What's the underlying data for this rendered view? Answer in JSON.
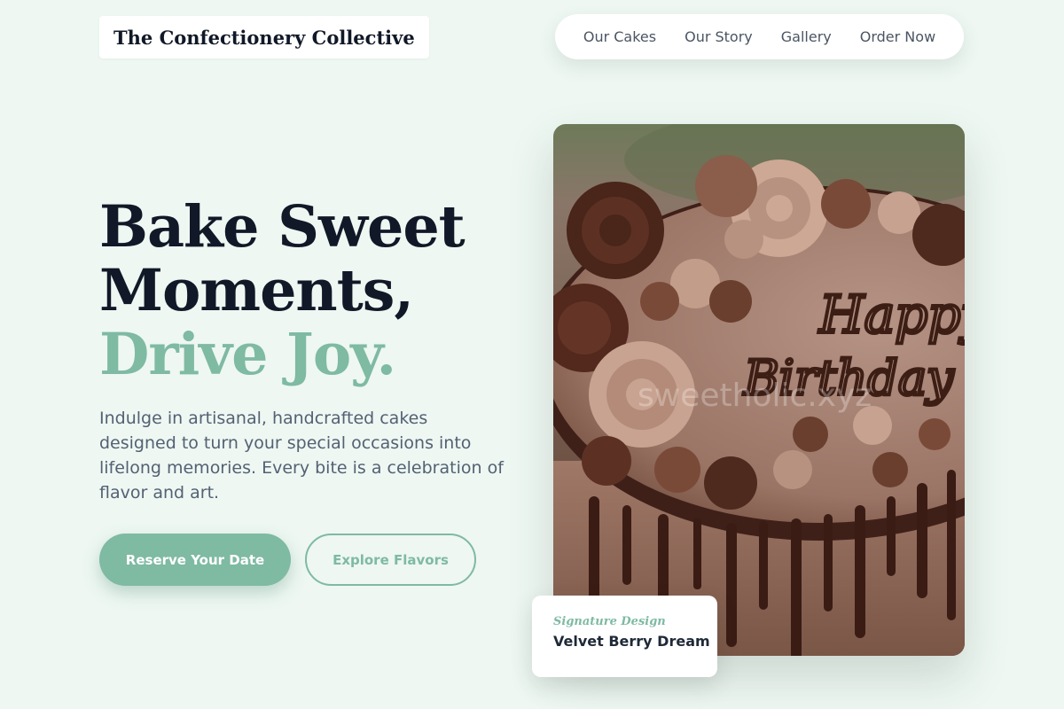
{
  "brand": {
    "name": "The Confectionery Collective"
  },
  "nav": {
    "items": [
      {
        "label": "Our Cakes"
      },
      {
        "label": "Our Story"
      },
      {
        "label": "Gallery"
      },
      {
        "label": "Order Now"
      }
    ]
  },
  "hero": {
    "headline_line1": "Bake Sweet",
    "headline_line2": "Moments,",
    "headline_accent": "Drive Joy.",
    "lead": "Indulge in artisanal, handcrafted cakes designed to turn your special occasions into lifelong memories. Every bite is a celebration of flavor and art.",
    "primary_cta": "Reserve Your Date",
    "secondary_cta": "Explore Flavors"
  },
  "image": {
    "cake_text_line1": "Happy",
    "cake_text_line2": "Birthday",
    "watermark": "sweetholic.xyz"
  },
  "feature_card": {
    "label": "Signature Design",
    "title": "Velvet Berry Dream"
  },
  "colors": {
    "accent": "#7fbaa3",
    "background": "#eef7f2",
    "heading": "#111827",
    "body_text": "#536173"
  }
}
